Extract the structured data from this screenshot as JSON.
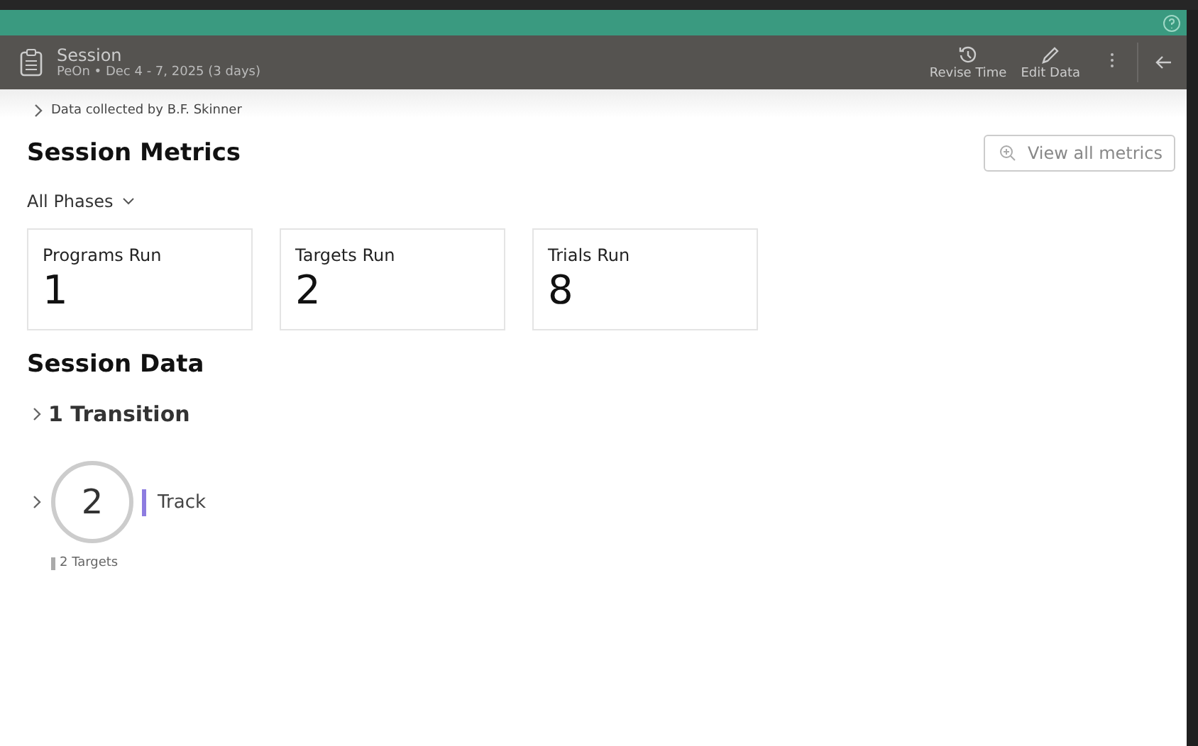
{
  "header": {
    "title": "Session",
    "subtitle": "PeOn • Dec 4 - 7, 2025 (3 days)",
    "actions": [
      {
        "kind": "revise",
        "label": "Revise Time"
      },
      {
        "kind": "edit",
        "label": "Edit Data"
      }
    ]
  },
  "collected_by": "Data collected by B.F. Skinner",
  "metrics": {
    "title": "Session Metrics",
    "view_all": "View all metrics",
    "phase_filter": "All Phases",
    "cards": [
      {
        "label": "Programs Run",
        "value": "1"
      },
      {
        "label": "Targets Run",
        "value": "2"
      },
      {
        "label": "Trials Run",
        "value": "8"
      }
    ]
  },
  "session_data": {
    "title": "Session Data",
    "transition": "1 Transition",
    "tracks": [
      {
        "count": "2",
        "label": "Track",
        "targets": "2 Targets"
      }
    ]
  }
}
